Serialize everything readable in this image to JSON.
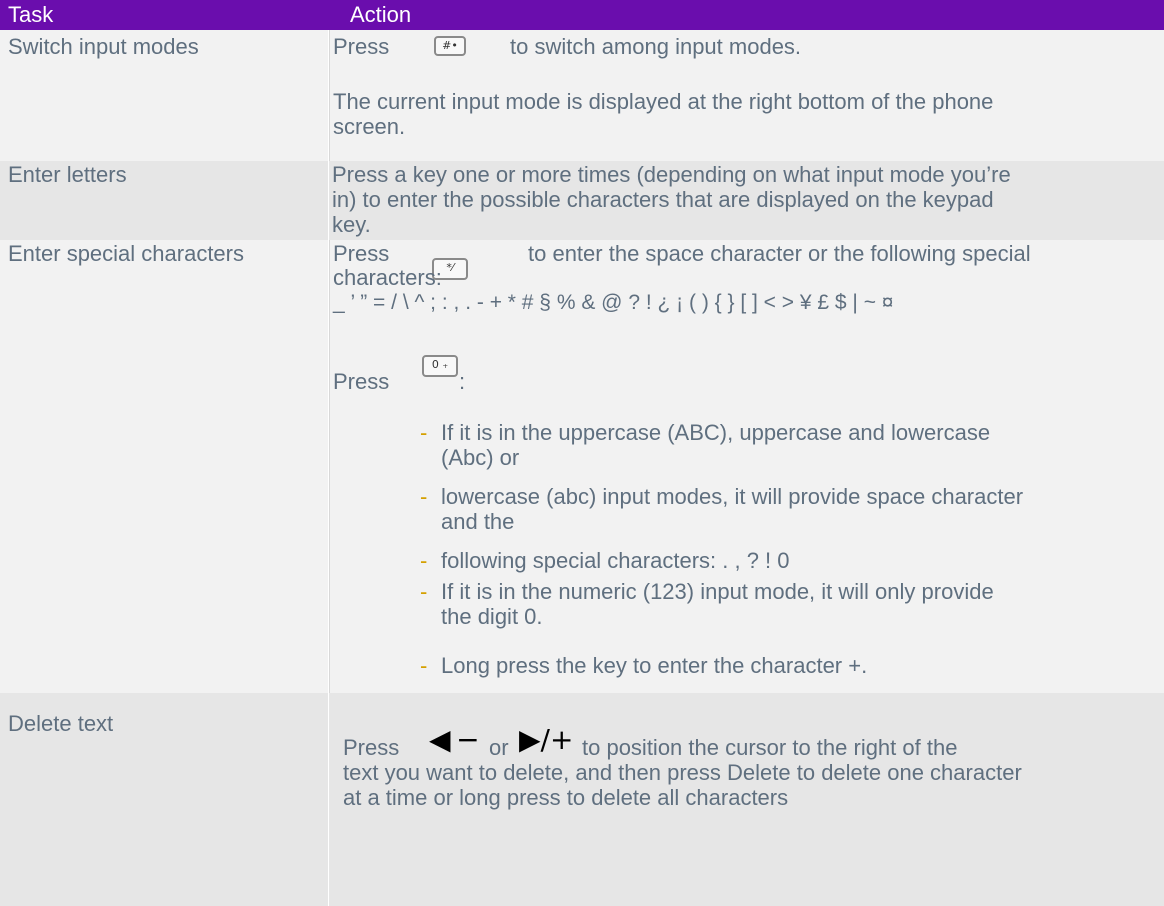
{
  "header": {
    "task": "Task",
    "action": "Action"
  },
  "rows": [
    {
      "task": "Switch input modes",
      "press": "Press",
      "key_icon": "hash-key-icon",
      "line1_after": "to switch among input modes.",
      "line2": "The current input mode is displayed at the right bottom of the phone",
      "line3": "screen."
    },
    {
      "task": "Enter letters",
      "line1": "Press a key one or more times (depending on what input mode you’re",
      "line2": "in) to enter the possible characters that are displayed on the  keypad",
      "line3": "key."
    },
    {
      "task": "Enter special characters",
      "press": "Press",
      "key_icon": "star-key-icon",
      "line1_after": "to enter the space character or the following special",
      "line2": "characters:",
      "specials": "_ ’ ” = / \\ ^ ; : , . - + * # § % & @ ? ! ¿ ¡ ( ) { } [ ] < > ¥  £ $ | ~ ¤",
      "press2": "Press",
      "key_icon2": "zero-key-icon",
      "colon": ":",
      "bullets": [
        [
          "If it is in the uppercase (ABC), uppercase and lowercase",
          "(Abc) or"
        ],
        [
          "lowercase (abc) input modes, it will provide space character",
          "and the"
        ],
        [
          "following special characters: . , ? ! 0"
        ],
        [
          "If it is in the numeric (123) input mode, it will only provide",
          "the digit 0."
        ],
        [
          "Long press the key to enter the character +."
        ]
      ],
      "bullet_mark": "-"
    },
    {
      "task": "Delete text",
      "press": "Press",
      "left_icon": "left-minus-icon",
      "or": "or",
      "right_icon": "right-plus-icon",
      "line1_after": "to position the cursor to the right of the",
      "line2": "text you want to delete, and then press Delete to delete one character",
      "line3": "at a time or long press to delete all characters"
    }
  ],
  "key_labels": {
    "hash": "#•",
    "star": "*⁄",
    "zero": "0 ₊"
  },
  "colors": {
    "header_bg": "#6a0dad",
    "row_bg": "#f2f2f2",
    "row_alt_bg": "#e6e6e6",
    "text": "#5f6f7f",
    "bullet": "#d4a000"
  }
}
